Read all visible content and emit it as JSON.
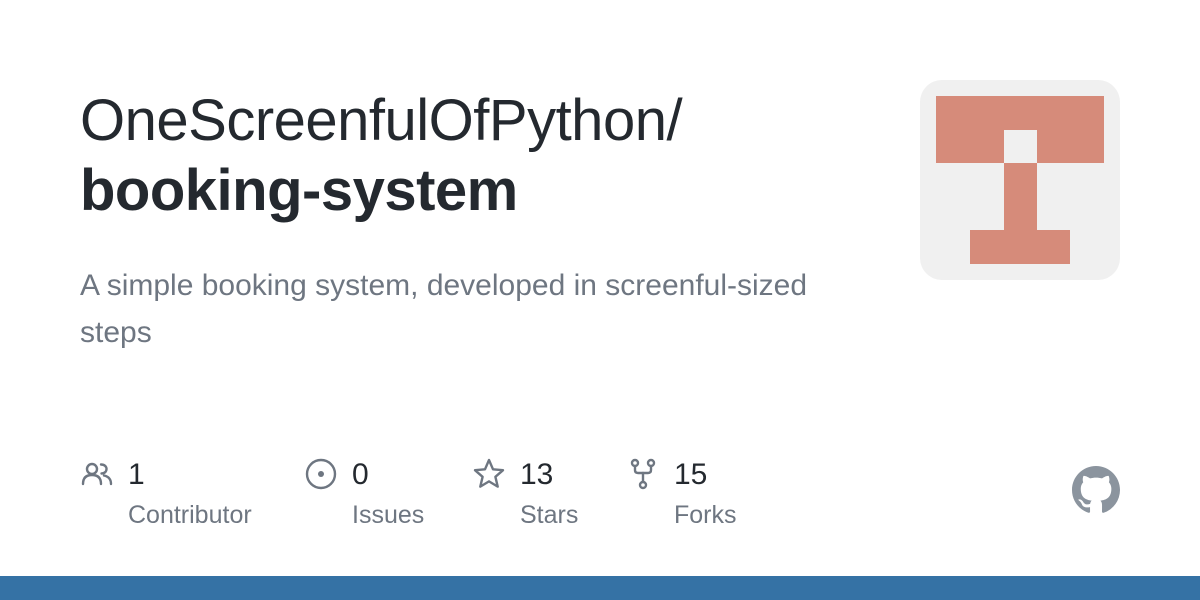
{
  "repo": {
    "owner": "OneScreenfulOfPython/",
    "name": "booking-system",
    "description": "A simple booking system, developed in screenful-sized steps"
  },
  "stats": [
    {
      "icon": "contributors-icon",
      "count": "1",
      "label": "Contributor"
    },
    {
      "icon": "issues-icon",
      "count": "0",
      "label": "Issues"
    },
    {
      "icon": "star-icon",
      "count": "13",
      "label": "Stars"
    },
    {
      "icon": "fork-icon",
      "count": "15",
      "label": "Forks"
    }
  ],
  "colors": {
    "avatar_fill": "#d68b7a",
    "avatar_background": "#f0f0f0",
    "language_bar": "#3572a5",
    "text_primary": "#24292f",
    "text_secondary": "#6e7681"
  }
}
